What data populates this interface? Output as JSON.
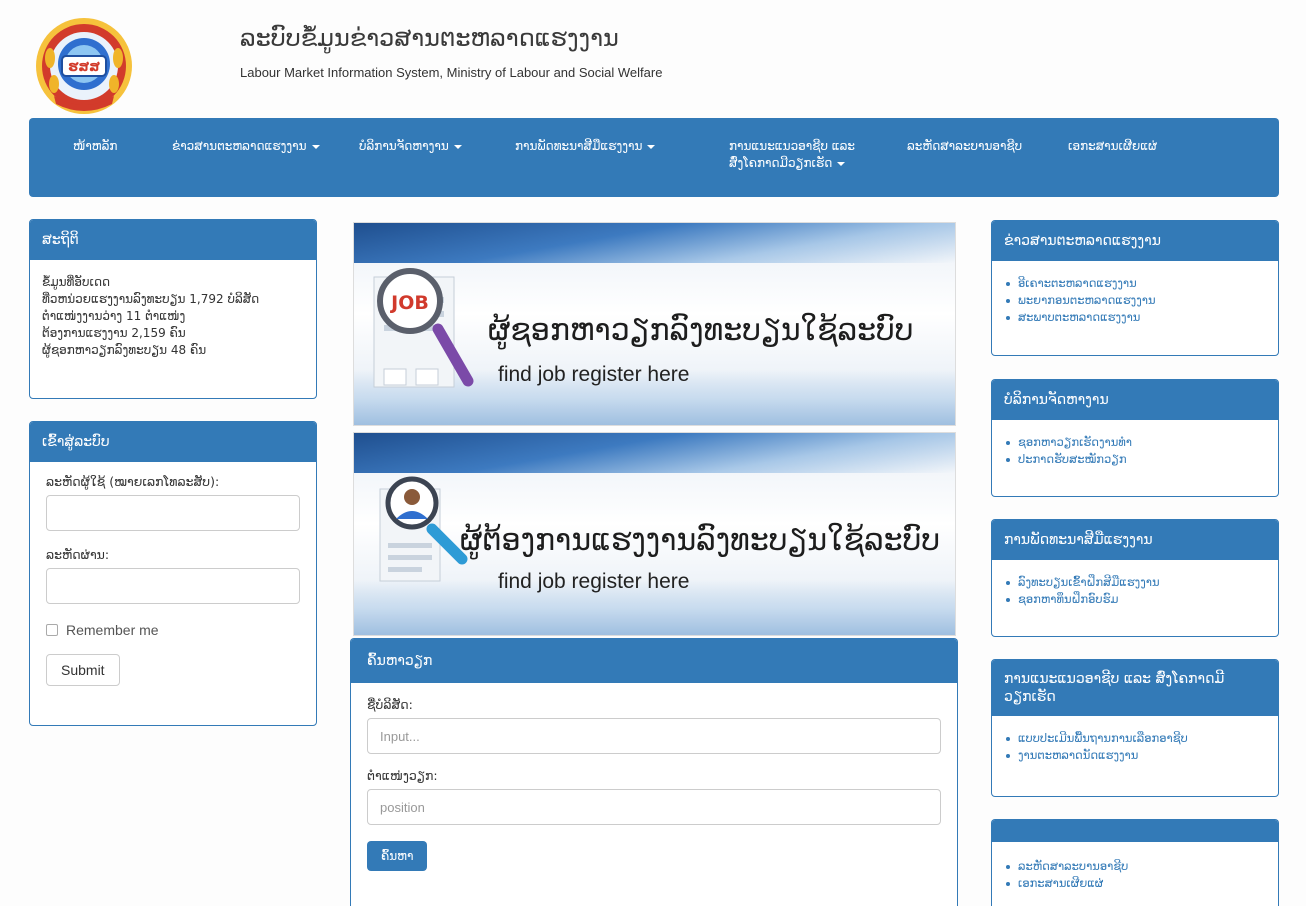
{
  "header": {
    "title": "ລະບົບຂໍ້ມູນຂ່າວສານຕະຫລາດແຮງງານ",
    "subtitle": "Labour Market Information System, Ministry of Labour and Social Welfare",
    "logo_text": "ຮສສ"
  },
  "nav": {
    "items": [
      {
        "label": "ໜ້າຫລັກ",
        "dropdown": false
      },
      {
        "label": "ຂ່າວສານຕະຫລາດແຮງງານ",
        "dropdown": true
      },
      {
        "label": "ບໍລິການຈັດຫາງານ",
        "dropdown": true
      },
      {
        "label": "ການພັດທະນາສີມືແຮງງານ",
        "dropdown": true
      },
      {
        "label": "ການແນະແນວອາຊີບ ແລະ",
        "label2": "ສົ່ງໂຄກາດມີວຽກເຮັດ",
        "dropdown": true
      },
      {
        "label": "ລະຫັດສາລະບານອາຊີບ",
        "dropdown": false
      },
      {
        "label": "ເອກະສານເຜີຍແຜ່",
        "dropdown": false
      }
    ]
  },
  "stats": {
    "heading": "ສະຖິຕິ",
    "lines": [
      "ຂໍ້ມູນທີ່ອັບເດດ",
      "ທີ່ວຫນ່ວຍແຮງງານລົງທະບຽນ 1,792 ບໍລິສັດ",
      "ຕໍາແໜ່ງງານວ່າງ 11 ຕໍາແໜ່ງ",
      "ຕ້ອງການແຮງງານ 2,159 ຄົນ",
      "ຜູ້ຊອກຫາວຽກລົງທະບຽນ 48 ຄົນ"
    ]
  },
  "login": {
    "heading": "ເຂົ້າສູ່ລະບົບ",
    "username_label": "ລະຫັດຜູ້ໃຊ້ (ໝາຍເລກໂທລະສັບ):",
    "username_value": "",
    "password_label": "ລະຫັດຜ່ານ:",
    "password_value": "",
    "remember_label": "Remember me",
    "submit_label": "Submit"
  },
  "banners": [
    {
      "badge": "JOB",
      "main_text": "ຜູ້ຊອກຫາວຽກລົງທະບຽນໃຊ້ລະບົບ",
      "sub_text": "find job register here"
    },
    {
      "main_text": "ຜູ້ຕ້ອງການແຮງງານລົງທະບຽນໃຊ້ລະບົບ",
      "sub_text": "find job register here"
    }
  ],
  "search": {
    "heading": "ຄົ້ນຫາວຽກ",
    "company_label": "ຊື່ບໍລິສັດ:",
    "company_placeholder": "Input...",
    "position_label": "ຕໍາແໜ່ງວຽກ:",
    "position_placeholder": "position",
    "button_label": "ຄົ້ນຫາ"
  },
  "right_panels": [
    {
      "heading": "ຂ່າວສານຕະຫລາດແຮງງານ",
      "links": [
        "ອີເຄາະຕະຫລາດແຮງງານ",
        "ພະຍາກອນຕະຫລາດແຮງງານ",
        "ສະພາບຕະຫລາດແຮງງານ"
      ]
    },
    {
      "heading": "ບໍລິການຈັດຫາງານ",
      "links": [
        "ຊອກຫາວຽກເຮັດງານທໍາ",
        "ປະກາດຮັບສະໝັກວຽກ"
      ]
    },
    {
      "heading": "ການພັດທະນາສີມືແຮງງານ",
      "links": [
        "ລົງທະບຽນເຂົ້າຝຶກສີມືແຮງງານ",
        "ຊອກຫາທຶນຝຶກອົບຮົມ"
      ]
    },
    {
      "heading": "ການແນະແນວອາຊີບ ແລະ ສົ່ງໂຄກາດມີ",
      "heading2": "ວຽກເຮັດ",
      "links": [
        "ແບບປະເມີນພື້ນຖານການເລືອກອາຊີບ",
        "ງານຕະຫລາດນັດແຮງງານ"
      ]
    },
    {
      "heading": "",
      "links": [
        "ລະຫັດສາລະບານອາຊີບ",
        "ເອກະສານເຜີຍແຜ່"
      ]
    }
  ],
  "colors": {
    "primary": "#337ab7",
    "logo_red": "#d23b2b",
    "logo_blue": "#1e4fa0",
    "logo_gold": "#e0a020"
  }
}
